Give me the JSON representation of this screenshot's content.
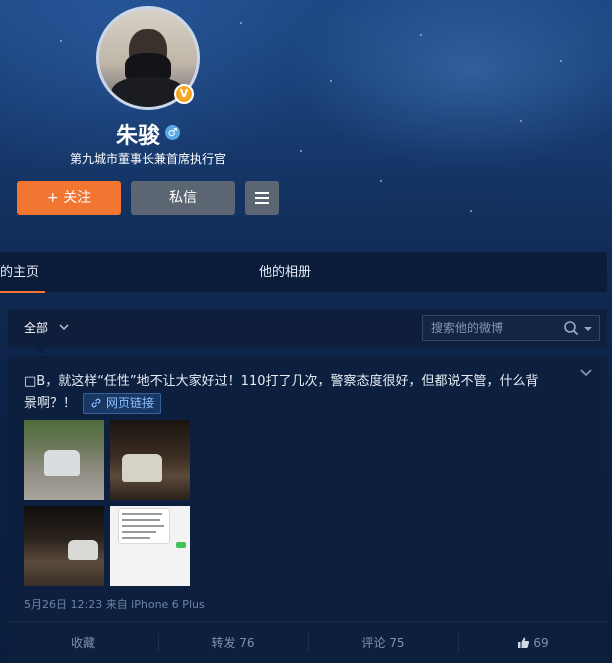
{
  "profile": {
    "name": "朱骏",
    "gender_symbol": "♂",
    "verified_badge": "V",
    "bio": "第九城市董事长兼首席执行官"
  },
  "actions": {
    "follow_label": "+ 关注",
    "message_label": "私信",
    "more_icon": "menu-icon"
  },
  "tabs": [
    {
      "label": "的主页",
      "active": true
    },
    {
      "label": "他的相册",
      "active": false
    }
  ],
  "filter": {
    "selected": "全部",
    "search_placeholder": "搜索他的微博"
  },
  "post": {
    "text_line1": "□B，就这样“任性”地不让大家好过！110打了几次，警察态度很好，但都说不管，什么背",
    "text_line2": "景啊？！",
    "link_label": "网页链接",
    "meta": "5月26日 12:23 来自 iPhone 6 Plus",
    "images": [
      "photo-1",
      "photo-2",
      "photo-3",
      "photo-4"
    ]
  },
  "post_actions": {
    "favorite": "收藏",
    "repost": "转发 76",
    "comment": "评论 75",
    "like_count": "69"
  },
  "colors": {
    "accent": "#f27632",
    "button_gray": "#5c6673",
    "card_bg": "#0c1f3e",
    "link": "#8fc0ff"
  }
}
